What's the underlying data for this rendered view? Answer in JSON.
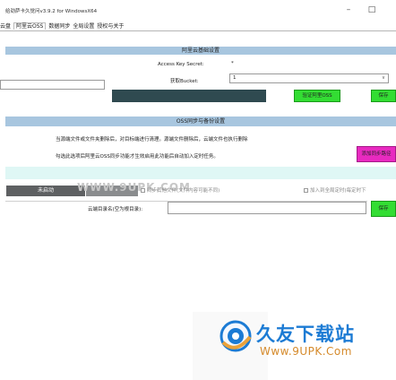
{
  "window": {
    "title": "给劲萨卡久觉问v3.9.2 for WindowsX64",
    "minimize": "–",
    "maximize": "□"
  },
  "menu": {
    "items": [
      "云盘",
      "阿里云OSS",
      "数据同步",
      "全局设置",
      "授权与关于"
    ]
  },
  "oss_config": {
    "title": "阿里云基础设置",
    "access_key_label": "Access Key Secret:",
    "access_key_value": "*",
    "bucket_label": "获取Bucket:",
    "bucket_value": "1",
    "verify_button": "验证阿里OSS",
    "save_button": "保存",
    "dropdown_arrow": "∨"
  },
  "sync": {
    "title": "OSS同步与备份设置",
    "note1": "当源端文件或文件夹删除后，对目标端进行清理。源端文件删除后，云端文件也执行删除",
    "note2": "勾选此选项后阿里云OSS同步功能才生效启用此功能后自动加入定时任务。",
    "magenta_button": "添加同步路径",
    "auto_start_button": "未启动",
    "checkbox_backup": "同步其他文件(文件内容可能不同)",
    "checkbox_timed": "加入到全局定时(每定时下",
    "cloud_dir_label": "云端目录名(空为根目录):",
    "cloud_dir_value": "",
    "save_button": "保存"
  },
  "watermark": {
    "text": "WWW.9UPK.COM",
    "logo_cn": "久友下载站",
    "logo_url": "Www.9UPK.Com"
  },
  "colors": {
    "band": "#a8c6df",
    "green": "#33dd33",
    "magenta": "#e82ac0",
    "dark": "#2f4a50",
    "mint": "#dff7f5"
  }
}
